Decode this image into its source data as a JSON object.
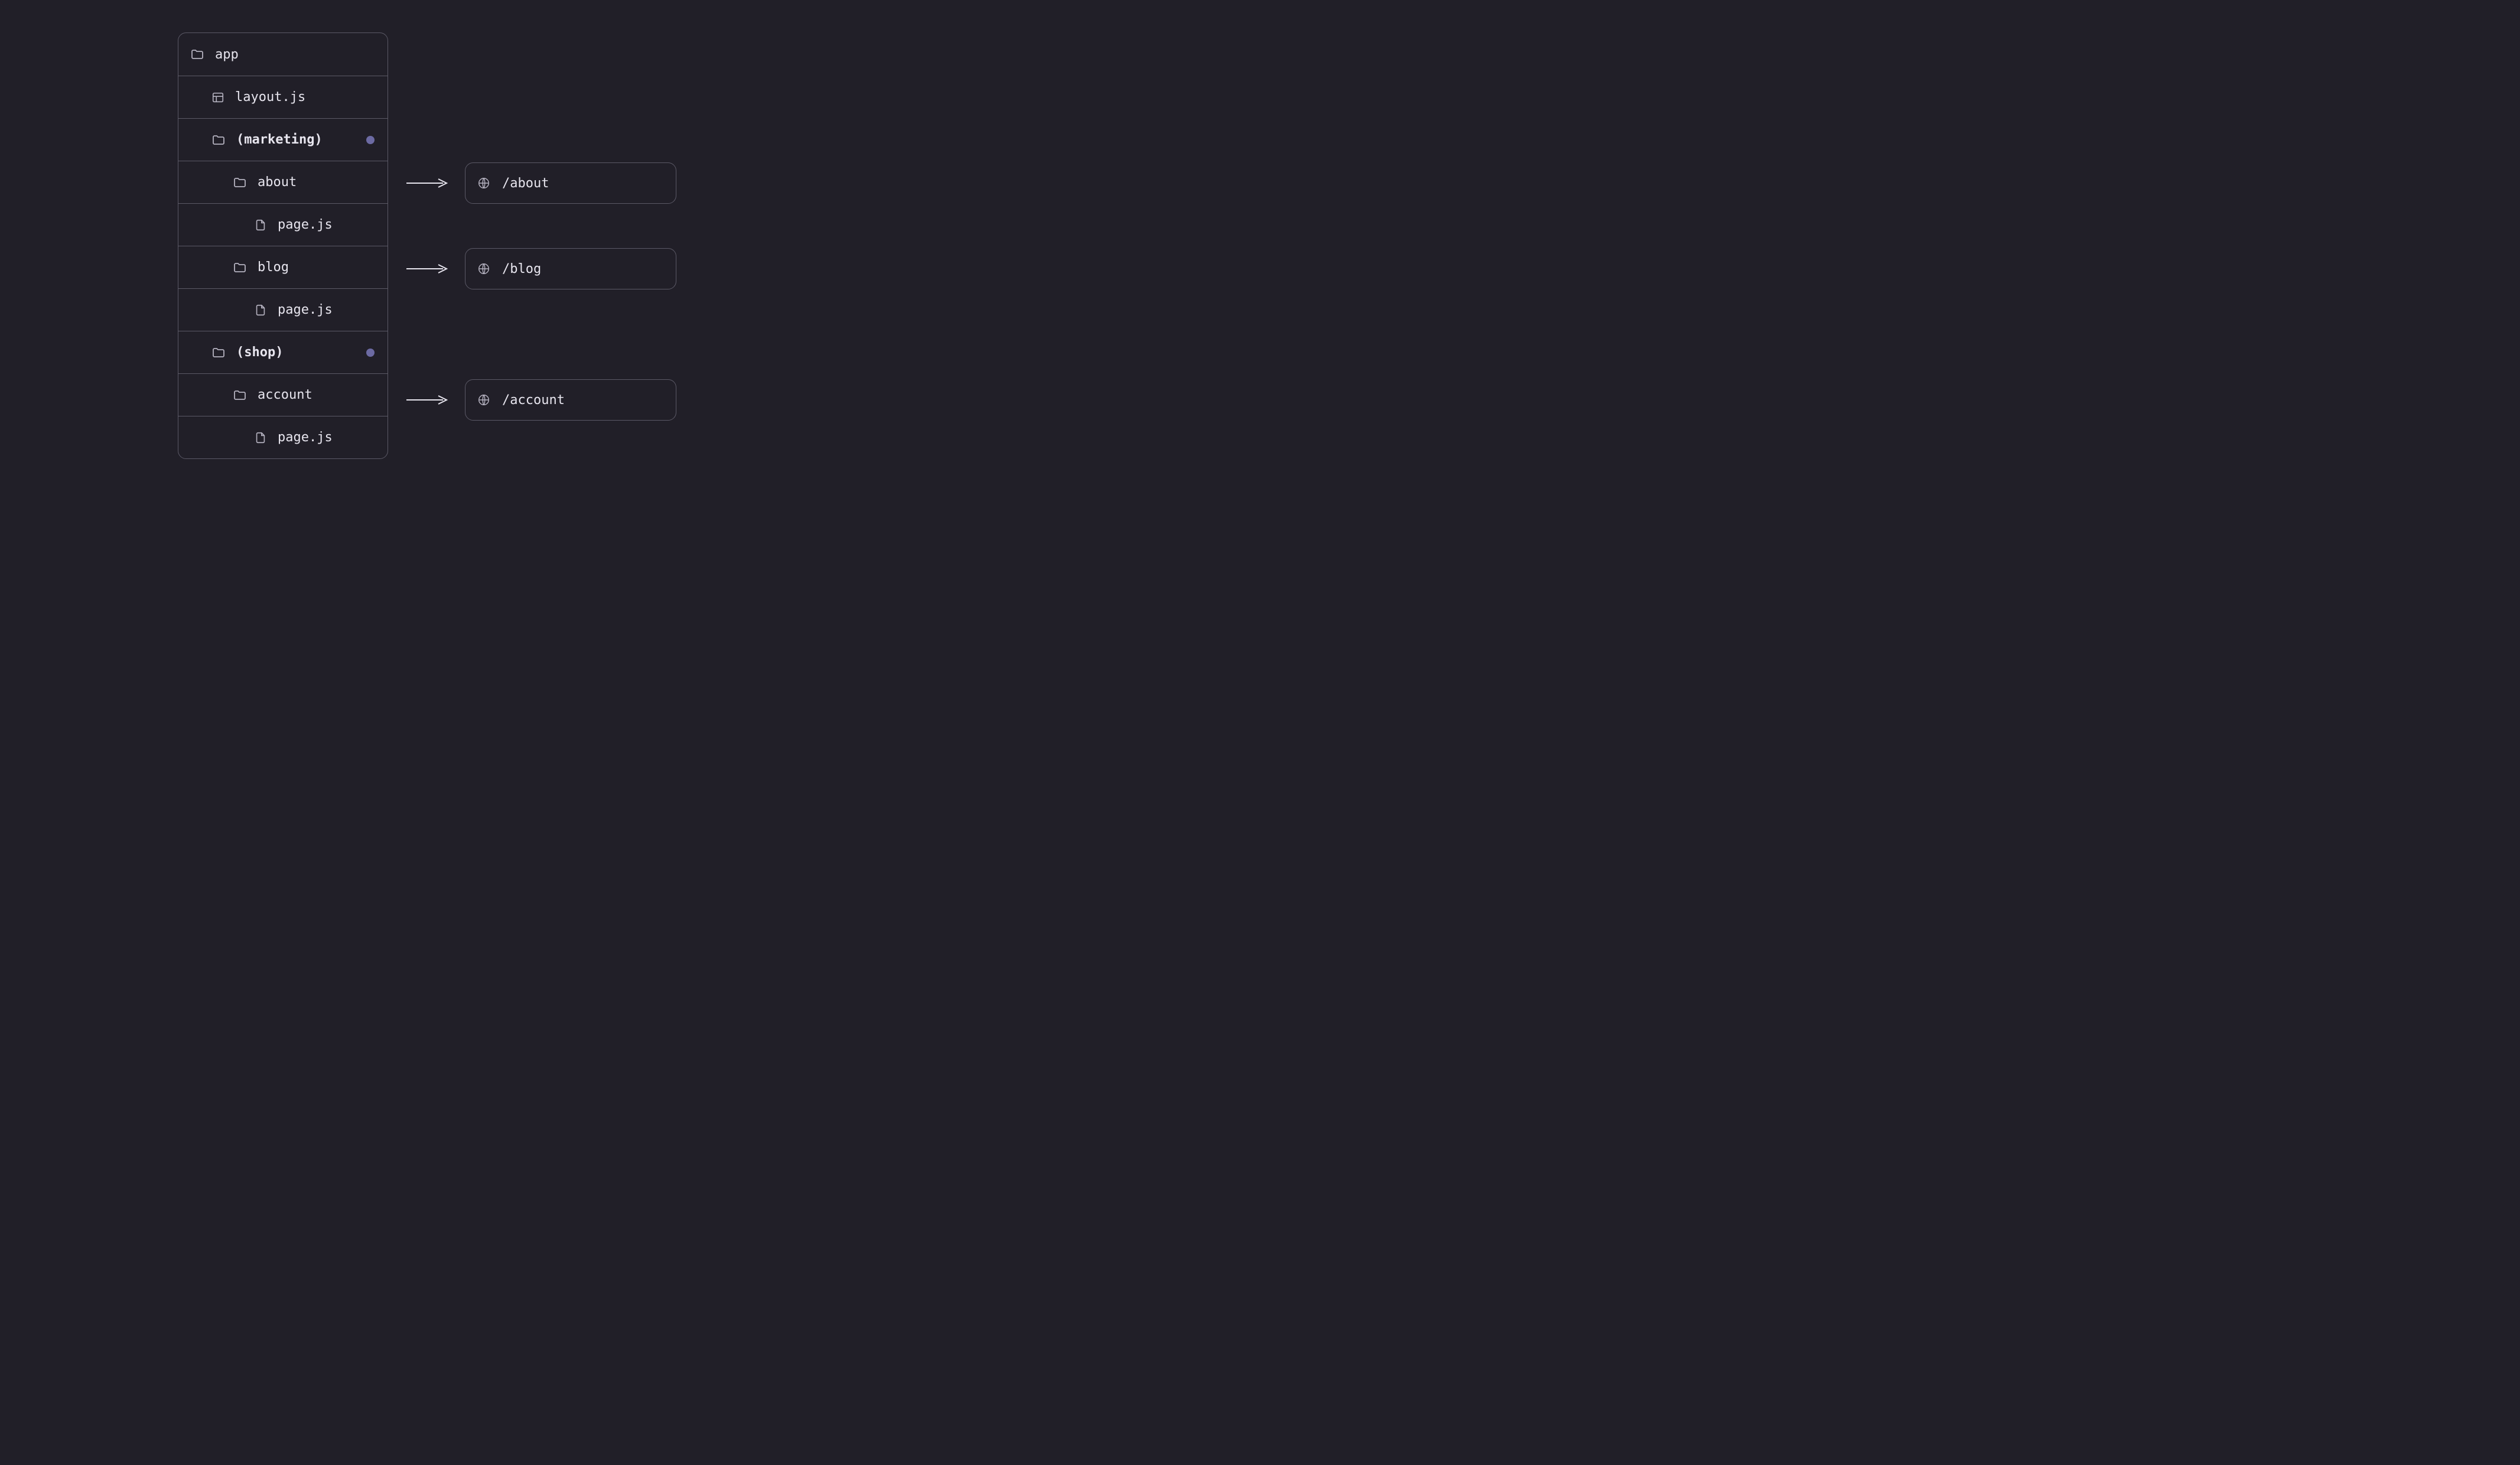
{
  "tree": {
    "root": "app",
    "layout": "layout.js",
    "marketing": {
      "name": "(marketing)",
      "about": {
        "name": "about",
        "page": "page.js"
      },
      "blog": {
        "name": "blog",
        "page": "page.js"
      }
    },
    "shop": {
      "name": "(shop)",
      "account": {
        "name": "account",
        "page": "page.js"
      }
    }
  },
  "urls": {
    "about": "/about",
    "blog": "/blog",
    "account": "/account"
  }
}
